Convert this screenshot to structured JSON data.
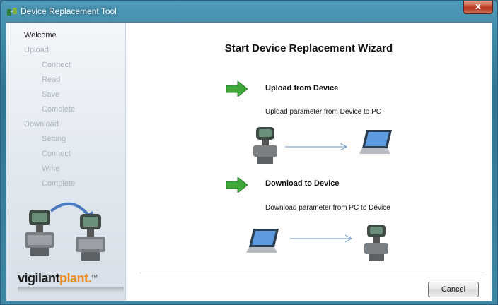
{
  "window": {
    "title": "Device Replacement Tool",
    "close_label": "x"
  },
  "sidebar": {
    "items": [
      {
        "label": "Welcome",
        "state": "active"
      },
      {
        "label": "Upload",
        "state": "inactive"
      },
      {
        "label": "Connect",
        "state": "inactive"
      },
      {
        "label": "Read",
        "state": "inactive"
      },
      {
        "label": "Save",
        "state": "inactive"
      },
      {
        "label": "Complete",
        "state": "inactive"
      },
      {
        "label": "Download",
        "state": "inactive"
      },
      {
        "label": "Setting",
        "state": "inactive"
      },
      {
        "label": "Connect",
        "state": "inactive"
      },
      {
        "label": "Write",
        "state": "inactive"
      },
      {
        "label": "Complete",
        "state": "inactive"
      }
    ],
    "logo": {
      "brand1": "vigilant",
      "brand2": "plant.",
      "tm": "TM"
    }
  },
  "main": {
    "heading": "Start Device Replacement Wizard",
    "upload": {
      "title": "Upload from Device",
      "desc": "Upload parameter from Device to PC"
    },
    "download": {
      "title": "Download to Device",
      "desc": "Download parameter from PC to Device"
    },
    "cancel_label": "Cancel"
  },
  "colors": {
    "arrow_green": "#3fa83a",
    "flow_line": "#6a93c8",
    "logo_orange": "#f08a1c",
    "inactive_text": "#a9b2bc"
  }
}
